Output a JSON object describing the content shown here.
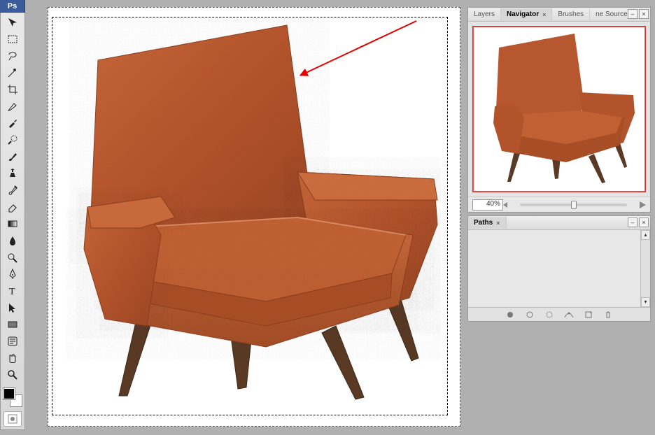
{
  "app": {
    "logo_text": "Ps"
  },
  "toolbar": {
    "tools": [
      "move-tool",
      "rectangular-marquee-tool",
      "lasso-tool",
      "magic-wand-tool",
      "crop-tool",
      "slice-tool",
      "eyedropper-tool",
      "spot-healing-tool",
      "brush-tool",
      "clone-stamp-tool",
      "history-brush-tool",
      "eraser-tool",
      "gradient-tool",
      "blur-tool",
      "dodge-tool",
      "pen-tool",
      "type-tool",
      "path-selection-tool",
      "rectangle-shape-tool",
      "notes-tool",
      "hand-tool",
      "zoom-tool"
    ],
    "foreground_color": "#000000",
    "background_color": "#ffffff"
  },
  "navigator": {
    "tabs": [
      "Layers",
      "Navigator",
      "Brushes",
      "ne Source"
    ],
    "active_tab": 1,
    "zoom_value": "40%"
  },
  "paths": {
    "tabs": [
      "Paths"
    ],
    "active_tab": 0
  },
  "annotation": {
    "arrow_color": "#e50000"
  },
  "colors": {
    "chair_fabric": "#b7572f",
    "chair_wood": "#5a3a25"
  }
}
